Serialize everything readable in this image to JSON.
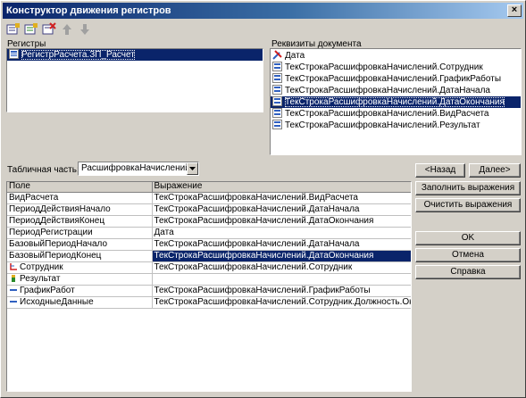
{
  "window": {
    "title": "Конструктор движения регистров",
    "close_glyph": "×"
  },
  "toolbar": {
    "icons": [
      "add-row-icon",
      "add-all-icon",
      "delete-icon",
      "move-up-icon",
      "move-down-icon"
    ]
  },
  "registers": {
    "label": "Регистры",
    "items": [
      {
        "label": "РегистрРасчета.ЗП_Расчет",
        "icon": "register-icon",
        "selected": true
      }
    ]
  },
  "attributes": {
    "label": "Реквизиты документа",
    "items": [
      {
        "label": "Дата",
        "icon": "date-icon",
        "selected": false
      },
      {
        "label": "ТекСтрокаРасшифровкаНачислений.Сотрудник",
        "icon": "attribute-icon",
        "selected": false
      },
      {
        "label": "ТекСтрокаРасшифровкаНачислений.ГрафикРаботы",
        "icon": "attribute-icon",
        "selected": false
      },
      {
        "label": "ТекСтрокаРасшифровкаНачислений.ДатаНачала",
        "icon": "attribute-icon",
        "selected": false
      },
      {
        "label": "ТекСтрокаРасшифровкаНачислений.ДатаОкончания",
        "icon": "attribute-icon",
        "selected": true
      },
      {
        "label": "ТекСтрокаРасшифровкаНачислений.ВидРасчета",
        "icon": "attribute-icon",
        "selected": false
      },
      {
        "label": "ТекСтрокаРасшифровкаНачислений.Результат",
        "icon": "attribute-icon",
        "selected": false
      }
    ]
  },
  "tabular": {
    "label": "Табличная часть:",
    "value": "РасшифровкаНачислений"
  },
  "grid": {
    "columns": [
      "Поле",
      "Выражение"
    ],
    "rows": [
      {
        "field": "ВидРасчета",
        "expression": "ТекСтрокаРасшифровкаНачислений.ВидРасчета",
        "icon": "",
        "selected": false
      },
      {
        "field": "ПериодДействияНачало",
        "expression": "ТекСтрокаРасшифровкаНачислений.ДатаНачала",
        "icon": "",
        "selected": false
      },
      {
        "field": "ПериодДействияКонец",
        "expression": "ТекСтрокаРасшифровкаНачислений.ДатаОкончания",
        "icon": "",
        "selected": false
      },
      {
        "field": "ПериодРегистрации",
        "expression": "Дата",
        "icon": "",
        "selected": false
      },
      {
        "field": "БазовыйПериодНачало",
        "expression": "ТекСтрокаРасшифровкаНачислений.ДатаНачала",
        "icon": "",
        "selected": false
      },
      {
        "field": "БазовыйПериодКонец",
        "expression": "ТекСтрокаРасшифровкаНачислений.ДатаОкончания",
        "icon": "",
        "selected": true
      },
      {
        "field": "Сотрудник",
        "expression": "ТекСтрокаРасшифровкаНачислений.Сотрудник",
        "icon": "dimension-icon",
        "selected": false
      },
      {
        "field": "Результат",
        "expression": "",
        "icon": "resource-icon",
        "selected": false
      },
      {
        "field": "ГрафикРабот",
        "expression": "ТекСтрокаРасшифровкаНачислений.ГрафикРаботы",
        "icon": "attribute-field-icon",
        "selected": false
      },
      {
        "field": "ИсходныеДанные",
        "expression": "ТекСтрокаРасшифровкаНачислений.Сотрудник.Должность.Оклад",
        "icon": "attribute-field-icon",
        "selected": false
      }
    ]
  },
  "buttons": {
    "back": "<Назад",
    "next": "Далее>",
    "fill": "Заполнить выражения",
    "clear": "Очистить выражения",
    "ok": "OK",
    "cancel": "Отмена",
    "help": "Справка"
  },
  "colors": {
    "selection": "#0a246a",
    "window_bg": "#d4d0c8",
    "title_start": "#0a246a",
    "title_end": "#a6caf0"
  }
}
